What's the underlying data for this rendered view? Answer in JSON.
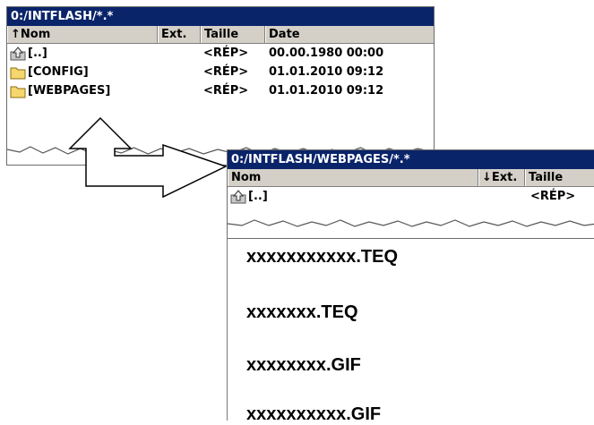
{
  "window1": {
    "title": "0:/INTFLASH/*.*",
    "columns": {
      "name": "↑Nom",
      "ext": "Ext.",
      "size": "Taille",
      "date": "Date"
    },
    "rows": [
      {
        "name": "[..]",
        "size": "<RÉP>",
        "date": "00.00.1980 00:00",
        "icon": "parent-folder-icon"
      },
      {
        "name": "[CONFIG]",
        "size": "<RÉP>",
        "date": "01.01.2010 09:12",
        "icon": "folder-icon"
      },
      {
        "name": "[WEBPAGES]",
        "size": "<RÉP>",
        "date": "01.01.2010 09:12",
        "icon": "folder-icon"
      }
    ]
  },
  "window2": {
    "title": "0:/INTFLASH/WEBPAGES/*.*",
    "columns": {
      "name": "Nom",
      "ext": "↓Ext.",
      "size": "Taille"
    },
    "rows": [
      {
        "name": "[..]",
        "size": "<RÉP>",
        "icon": "parent-folder-icon"
      }
    ]
  },
  "files": [
    "xxxxxxxxxxx.TEQ",
    "xxxxxxx.TEQ",
    "xxxxxxxx.GIF",
    "xxxxxxxxxx.GIF"
  ],
  "colors": {
    "titlebar": "#0a246a",
    "header": "#d4d0c8",
    "folder": "#f5d76e"
  }
}
